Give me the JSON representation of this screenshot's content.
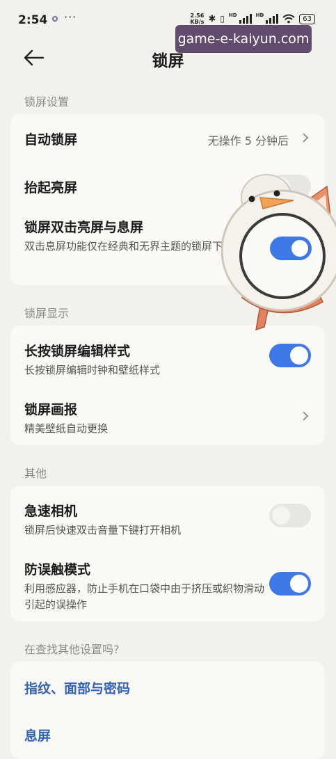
{
  "status_bar": {
    "time": "2:54",
    "more": "···",
    "speed_value": "2.56",
    "speed_unit": "KB/s",
    "hd1": "HD",
    "hd2": "HD",
    "battery": "63"
  },
  "watermark": {
    "text": "game-e-kaiyun.com"
  },
  "header": {
    "title": "锁屏",
    "back_icon": "arrow-left-icon"
  },
  "sections": {
    "lock_settings": {
      "header": "锁屏设置",
      "auto_lock": {
        "title": "自动锁屏",
        "value": "无操作 5 分钟后"
      },
      "raise_wake": {
        "title": "抬起亮屏",
        "enabled": false
      },
      "double_tap": {
        "title": "锁屏双击亮屏与息屏",
        "subtitle": "双击息屏功能仅在经典和无界主题的锁屏下生效",
        "enabled": true
      }
    },
    "lock_display": {
      "header": "锁屏显示",
      "long_press_edit": {
        "title": "长按锁屏编辑样式",
        "subtitle": "长按锁屏编辑时钟和壁纸样式",
        "enabled": true
      },
      "lock_magazine": {
        "title": "锁屏画报",
        "subtitle": "精美壁纸自动更换"
      }
    },
    "other": {
      "header": "其他",
      "quick_camera": {
        "title": "急速相机",
        "subtitle": "锁屏后快速双击音量下键打开相机",
        "enabled": false
      },
      "anti_mistouch": {
        "title": "防误触模式",
        "subtitle": "利用感应器，防止手机在口袋中由于挤压或织物滑动引起的误操作",
        "enabled": true
      }
    },
    "more_settings": {
      "header": "在查找其他设置吗?",
      "links": [
        "指纹、面部与密码",
        "息屏"
      ]
    }
  },
  "colors": {
    "accent": "#3f78e8",
    "link": "#3262b7",
    "background": "#f3f1ec",
    "card": "#faf9f5"
  }
}
